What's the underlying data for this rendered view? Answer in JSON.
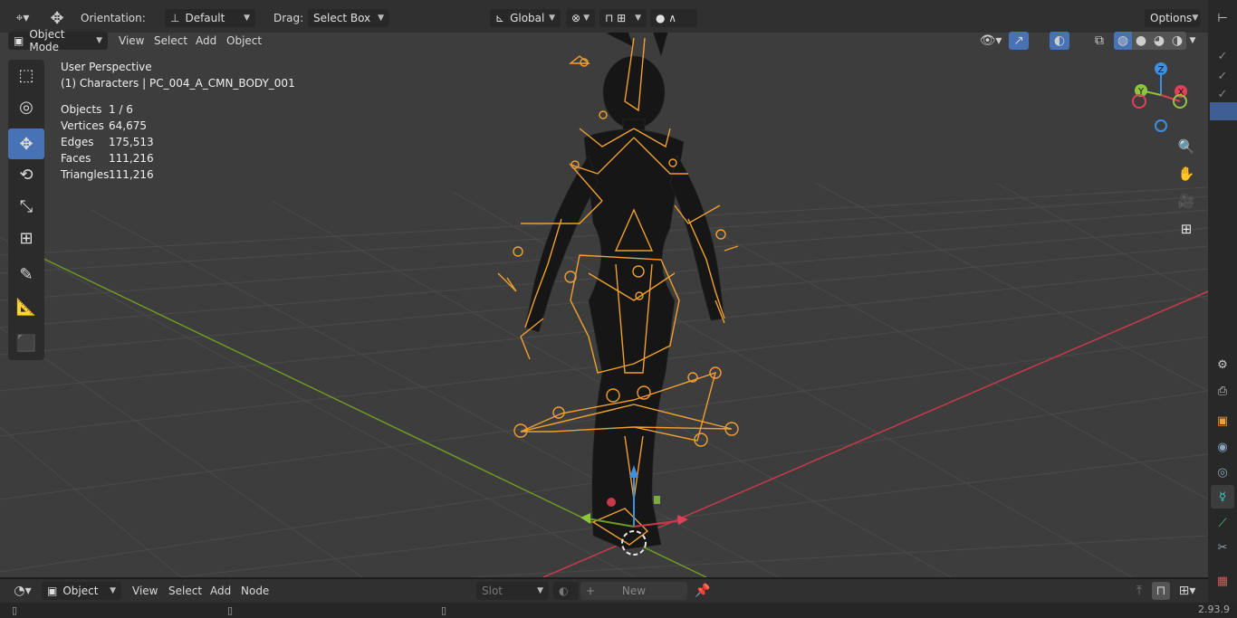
{
  "top_header": {
    "orientation_label": "Orientation:",
    "orientation_value": "Default",
    "drag_label": "Drag:",
    "drag_value": "Select Box",
    "transform_space": "Global",
    "options_label": "Options"
  },
  "viewport_header": {
    "mode": "Object Mode",
    "menus": [
      "View",
      "Select",
      "Add",
      "Object"
    ]
  },
  "overlay": {
    "perspective": "User Perspective",
    "collection_object": "(1) Characters | PC_004_A_CMN_BODY_001",
    "stats": [
      {
        "label": "Objects",
        "value": "1 / 6"
      },
      {
        "label": "Vertices",
        "value": "64,675"
      },
      {
        "label": "Edges",
        "value": "175,513"
      },
      {
        "label": "Faces",
        "value": "111,216"
      },
      {
        "label": "Triangles",
        "value": "111,216"
      }
    ]
  },
  "tools": [
    "select-box-icon",
    "cursor-icon",
    "move-icon",
    "rotate-icon",
    "scale-icon",
    "transform-icon",
    "annotate-icon",
    "measure-icon",
    "add-cube-icon"
  ],
  "gizmo": {
    "z": "Z",
    "y": "Y",
    "x": "X"
  },
  "bottom_header": {
    "object_type": "Object",
    "menus": [
      "View",
      "Select",
      "Add",
      "Node"
    ],
    "slot": "Slot",
    "new_label": "New"
  },
  "status": {
    "version": "2.93.9"
  },
  "colors": {
    "accent": "#4772b3",
    "armature": "#f0a030",
    "x_axis": "#c8394a",
    "y_axis": "#6e9a23"
  }
}
